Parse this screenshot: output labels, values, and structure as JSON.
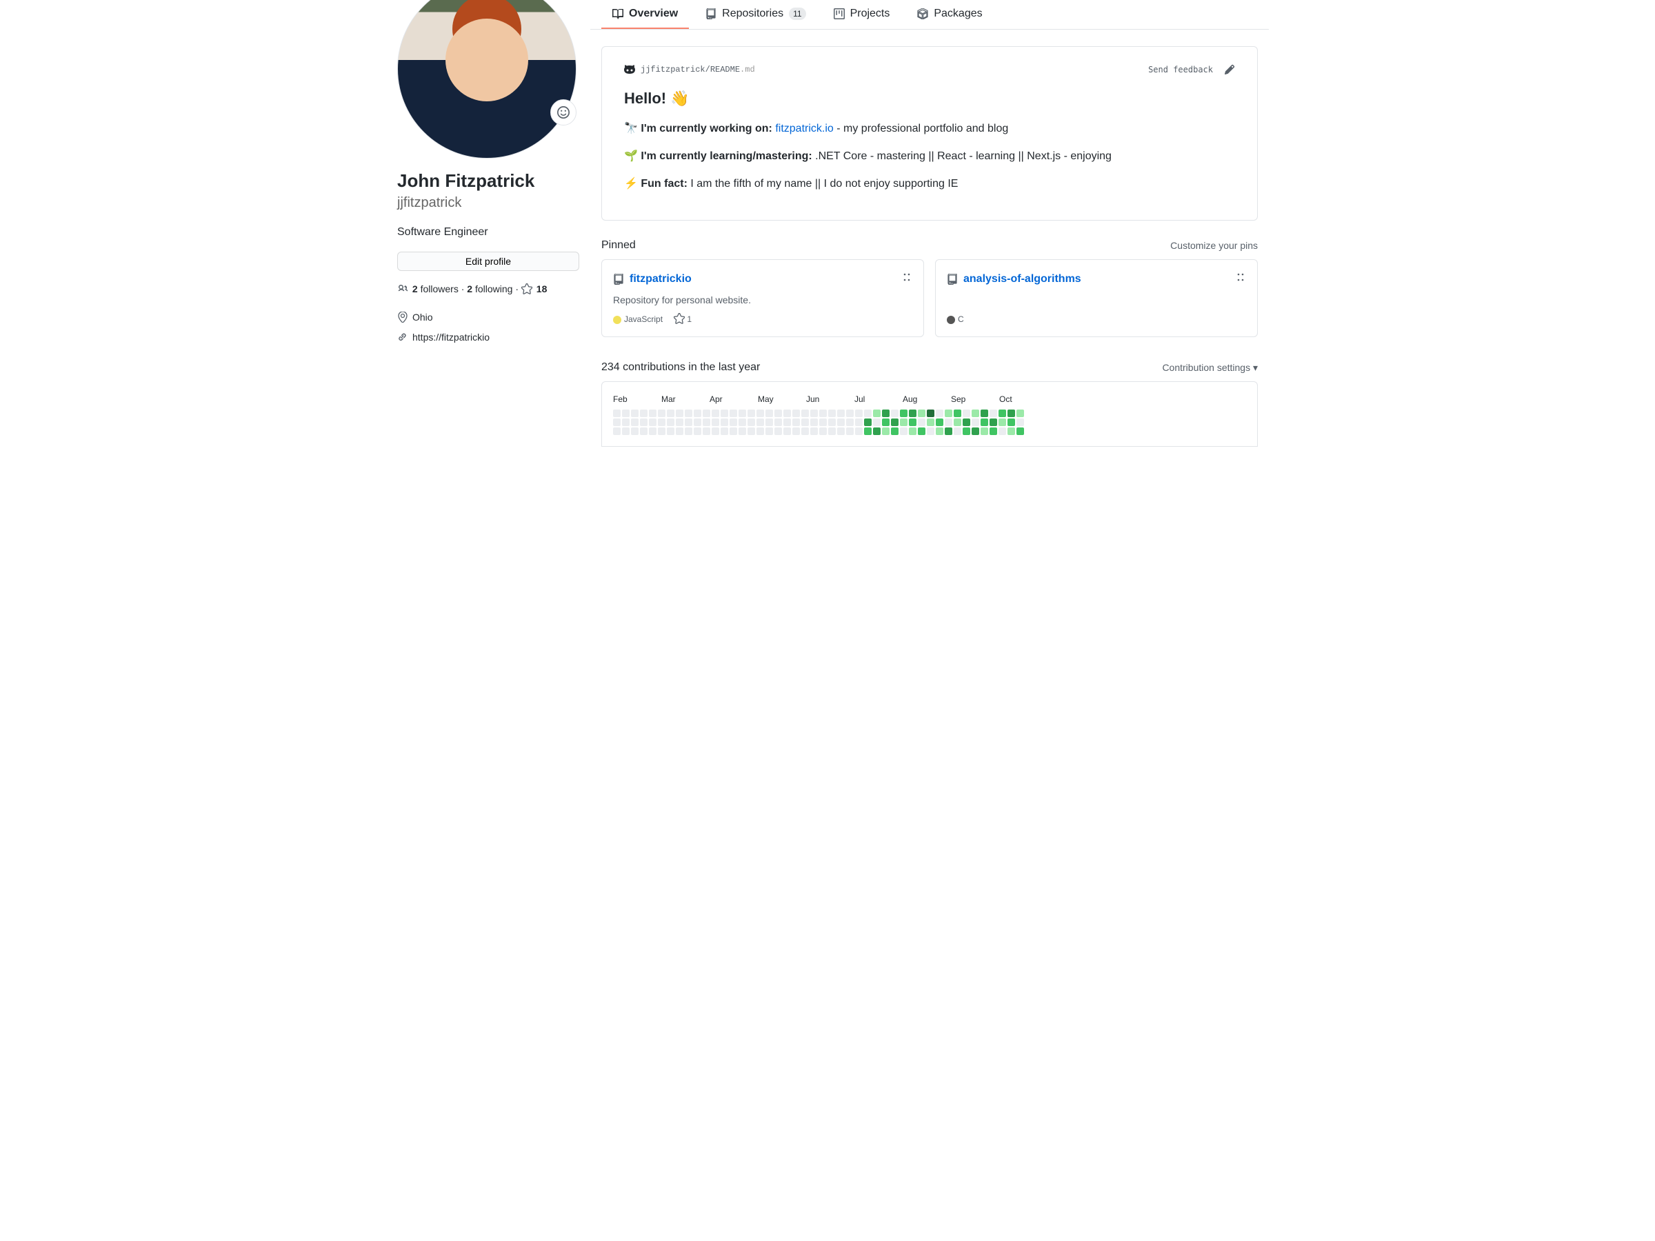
{
  "sidebar": {
    "fullname": "John Fitzpatrick",
    "username": "jjfitzpatrick",
    "bio": "Software Engineer",
    "edit_label": "Edit profile",
    "followers_count": "2",
    "followers_label": "followers",
    "following_count": "2",
    "following_label": "following",
    "stars_count": "18",
    "location": "Ohio",
    "website": "https://fitzpatrickio"
  },
  "tabs": {
    "overview": "Overview",
    "repositories": "Repositories",
    "repositories_count": "11",
    "projects": "Projects",
    "packages": "Packages"
  },
  "readme": {
    "username": "jjfitzpatrick",
    "file": "README",
    "ext": ".md",
    "send_feedback": "Send feedback",
    "heading": "Hello! 👋",
    "working_label": "I'm currently working on:",
    "working_link": "fitzpatrick.io",
    "working_rest": " - my professional portfolio and blog",
    "learning_label": "I'm currently learning/mastering:",
    "learning_rest": " .NET Core - mastering || React - learning || Next.js - enjoying",
    "fun_label": "Fun fact:",
    "fun_rest": " I am the fifth of my name || I do not enjoy supporting IE"
  },
  "pinned": {
    "title": "Pinned",
    "customize": "Customize your pins",
    "items": [
      {
        "name": "fitzpatrickio",
        "desc": "Repository for personal website.",
        "lang": "JavaScript",
        "lang_color": "#f1e05a",
        "stars": "1"
      },
      {
        "name": "analysis-of-algorithms",
        "desc": "",
        "lang": "C",
        "lang_color": "#555555",
        "stars": ""
      }
    ]
  },
  "contrib": {
    "heading": "234 contributions in the last year",
    "settings": "Contribution settings ",
    "months": [
      "Feb",
      "Mar",
      "Apr",
      "May",
      "Jun",
      "Jul",
      "Aug",
      "Sep",
      "Oct"
    ]
  }
}
